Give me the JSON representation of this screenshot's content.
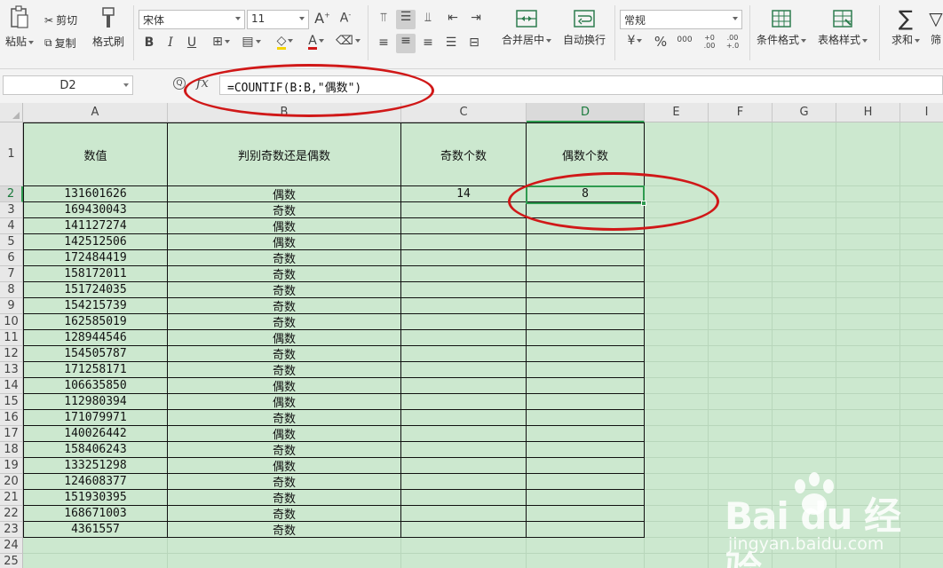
{
  "ribbon": {
    "paste_label": "粘贴",
    "cut_label": "剪切",
    "copy_label": "复制",
    "format_painter_label": "格式刷",
    "font_name": "宋体",
    "font_size": "11",
    "grow_font": "A",
    "shrink_font": "A",
    "bold": "B",
    "italic": "I",
    "underline": "U",
    "font_color_glyph": "A",
    "merge_center_label": "合并居中",
    "wrap_text_label": "自动换行",
    "number_format": "常规",
    "currency_glyph": "¥",
    "percent_glyph": "%",
    "thousands_glyph": "000",
    "inc_decimal_glyph": "+0 .00",
    "dec_decimal_glyph": ".00 +.0",
    "cond_format_label": "条件格式",
    "table_style_label": "表格样式",
    "sum_label": "求和",
    "filter_label": "筛"
  },
  "formula_bar": {
    "cell_ref": "D2",
    "fx": "fx",
    "formula": "=COUNTIF(B:B,\"偶数\")"
  },
  "columns": [
    "A",
    "B",
    "C",
    "D",
    "E",
    "F",
    "G",
    "H",
    "I"
  ],
  "selected_column": "D",
  "selected_row": 2,
  "header_row": {
    "a": "数值",
    "b": "判别奇数还是偶数",
    "c": "奇数个数",
    "d": "偶数个数"
  },
  "rows": [
    {
      "num": "2",
      "a": "131601626",
      "b": "偶数",
      "c": "14",
      "d": "8"
    },
    {
      "num": "3",
      "a": "169430043",
      "b": "奇数",
      "c": "",
      "d": ""
    },
    {
      "num": "4",
      "a": "141127274",
      "b": "偶数",
      "c": "",
      "d": ""
    },
    {
      "num": "5",
      "a": "142512506",
      "b": "偶数",
      "c": "",
      "d": ""
    },
    {
      "num": "6",
      "a": "172484419",
      "b": "奇数",
      "c": "",
      "d": ""
    },
    {
      "num": "7",
      "a": "158172011",
      "b": "奇数",
      "c": "",
      "d": ""
    },
    {
      "num": "8",
      "a": "151724035",
      "b": "奇数",
      "c": "",
      "d": ""
    },
    {
      "num": "9",
      "a": "154215739",
      "b": "奇数",
      "c": "",
      "d": ""
    },
    {
      "num": "10",
      "a": "162585019",
      "b": "奇数",
      "c": "",
      "d": ""
    },
    {
      "num": "11",
      "a": "128944546",
      "b": "偶数",
      "c": "",
      "d": ""
    },
    {
      "num": "12",
      "a": "154505787",
      "b": "奇数",
      "c": "",
      "d": ""
    },
    {
      "num": "13",
      "a": "171258171",
      "b": "奇数",
      "c": "",
      "d": ""
    },
    {
      "num": "14",
      "a": "106635850",
      "b": "偶数",
      "c": "",
      "d": ""
    },
    {
      "num": "15",
      "a": "112980394",
      "b": "偶数",
      "c": "",
      "d": ""
    },
    {
      "num": "16",
      "a": "171079971",
      "b": "奇数",
      "c": "",
      "d": ""
    },
    {
      "num": "17",
      "a": "140026442",
      "b": "偶数",
      "c": "",
      "d": ""
    },
    {
      "num": "18",
      "a": "158406243",
      "b": "奇数",
      "c": "",
      "d": ""
    },
    {
      "num": "19",
      "a": "133251298",
      "b": "偶数",
      "c": "",
      "d": ""
    },
    {
      "num": "20",
      "a": "124608377",
      "b": "奇数",
      "c": "",
      "d": ""
    },
    {
      "num": "21",
      "a": "151930395",
      "b": "奇数",
      "c": "",
      "d": ""
    },
    {
      "num": "22",
      "a": "168671003",
      "b": "奇数",
      "c": "",
      "d": ""
    },
    {
      "num": "23",
      "a": "4361557",
      "b": "奇数",
      "c": "",
      "d": ""
    }
  ],
  "extra_rows": [
    "24",
    "25"
  ],
  "watermark": {
    "brand": "Bai du 经验",
    "url": "jingyan.baidu.com"
  },
  "colors": {
    "sheet_bg": "#cce8cf",
    "selection": "#2e9b4f",
    "annotation": "#d01818",
    "ribbon_bg": "#f3f3f3"
  }
}
